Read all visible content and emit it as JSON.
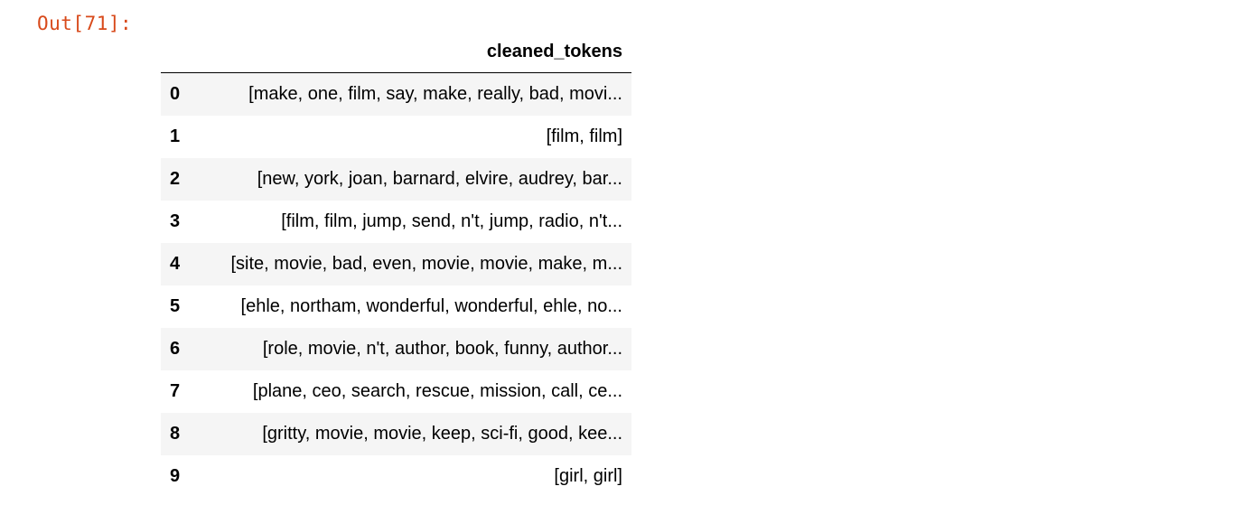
{
  "prompt": "Out[71]:",
  "table": {
    "column": "cleaned_tokens",
    "rows": [
      {
        "index": "0",
        "value": "[make, one, film, say, make, really, bad, movi..."
      },
      {
        "index": "1",
        "value": "[film, film]"
      },
      {
        "index": "2",
        "value": "[new, york, joan, barnard, elvire, audrey, bar..."
      },
      {
        "index": "3",
        "value": "[film, film, jump, send, n't, jump, radio, n't..."
      },
      {
        "index": "4",
        "value": "[site, movie, bad, even, movie, movie, make, m..."
      },
      {
        "index": "5",
        "value": "[ehle, northam, wonderful, wonderful, ehle, no..."
      },
      {
        "index": "6",
        "value": "[role, movie, n't, author, book, funny, author..."
      },
      {
        "index": "7",
        "value": "[plane, ceo, search, rescue, mission, call, ce..."
      },
      {
        "index": "8",
        "value": "[gritty, movie, movie, keep, sci-fi, good, kee..."
      },
      {
        "index": "9",
        "value": "[girl, girl]"
      }
    ]
  }
}
